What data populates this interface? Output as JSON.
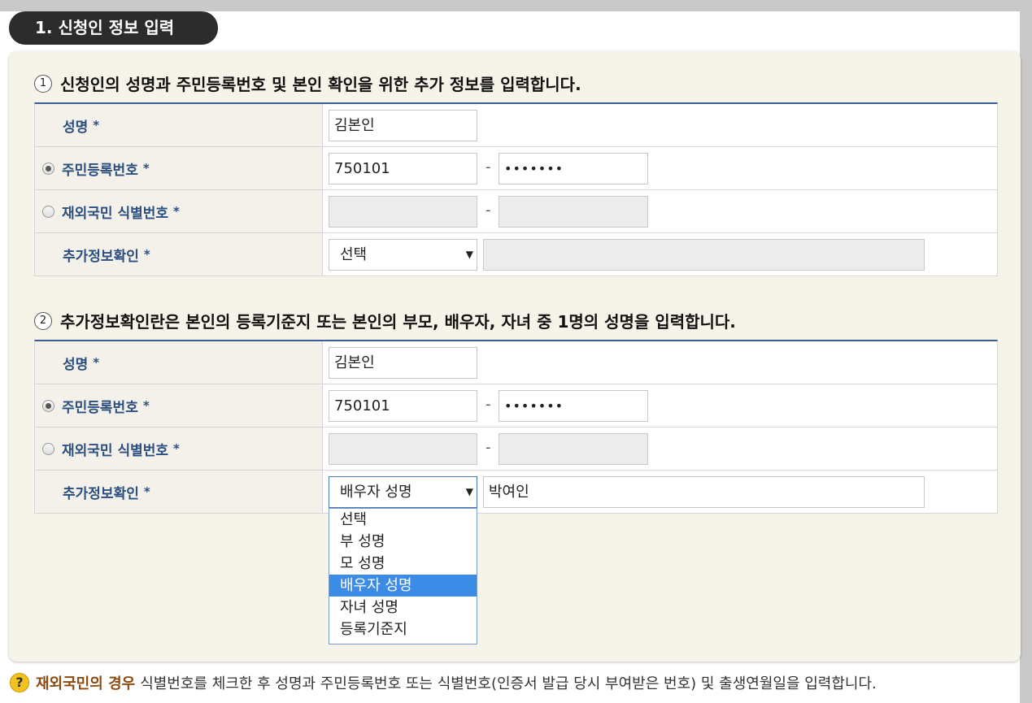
{
  "section_title": "1. 신청인 정보 입력",
  "section1": {
    "num": "1",
    "heading": "신청인의 성명과 주민등록번호 및 본인 확인을 위한 추가 정보를 입력합니다.",
    "rows": {
      "name_label": "성명",
      "resident_label": "주민등록번호",
      "overseas_label": "재외국민 식별번호",
      "extra_label": "추가정보확인"
    },
    "name_value": "김본인",
    "resident_front": "750101",
    "resident_back": "•••••••",
    "extra_select": "선택",
    "extra_value": ""
  },
  "section2": {
    "num": "2",
    "heading": "추가정보확인란은 본인의 등록기준지 또는 본인의 부모, 배우자, 자녀 중 1명의 성명을 입력합니다.",
    "rows": {
      "name_label": "성명",
      "resident_label": "주민등록번호",
      "overseas_label": "재외국민 식별번호",
      "extra_label": "추가정보확인"
    },
    "name_value": "김본인",
    "resident_front": "750101",
    "resident_back": "•••••••",
    "extra_select": "배우자 성명",
    "extra_value": "박여인"
  },
  "required_mark": "*",
  "dash": "-",
  "select_arrow": "▼",
  "dropdown_options": [
    "선택",
    "부 성명",
    "모 성명",
    "배우자 성명",
    "자녀 성명",
    "등록기준지"
  ],
  "dropdown_selected_index": 3,
  "footer": {
    "icon": "?",
    "bold": "재외국민의 경우",
    "text": "식별번호를 체크한 후 성명과 주민등록번호 또는 식별번호(인증서 발급 당시 부여받은 번호) 및 출생연월일을 입력합니다."
  },
  "colors": {
    "header_bar": "#3b5e93",
    "label_text": "#2b4f80",
    "panel_bg": "#f6f3e8",
    "highlight": "#3c8ce7"
  }
}
